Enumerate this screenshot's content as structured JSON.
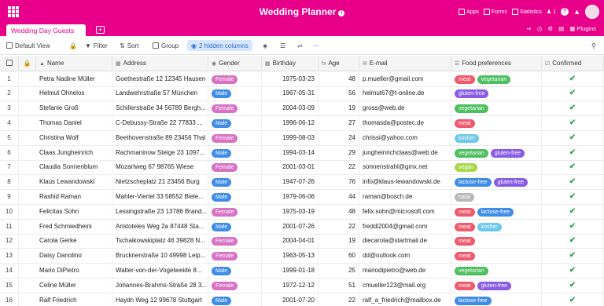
{
  "app": {
    "title": "Wedding Planner",
    "top_links": {
      "apps": "Apps",
      "forms": "Forms",
      "statistics": "Statistics",
      "users": "1"
    }
  },
  "tab": {
    "name": "Wedding Day Guests",
    "add": "+",
    "plugins": "Plugins"
  },
  "toolbar": {
    "view": "Default View",
    "filter": "Filter",
    "sort": "Sort",
    "group": "Group",
    "hidden": "2 hidden columns"
  },
  "columns": {
    "name": "Name",
    "address": "Address",
    "gender": "Gender",
    "birthday": "Birthday",
    "age": "Age",
    "email": "E-mail",
    "food": "Food preferences",
    "confirmed": "Confirmed"
  },
  "colors": {
    "brand": "#e8008a",
    "female": "#d772c4",
    "male": "#3f8de8",
    "meat": "#ef5a6f",
    "vegetarian": "#4cbf5e",
    "gluten-free": "#8a5ce6",
    "kosher": "#6fc8ea",
    "lactose-free": "#3f8de8",
    "vegan": "#a8d84a",
    "halal": "#b8b8b8"
  },
  "rows": [
    {
      "num": "1",
      "name": "Petra Nadine Müller",
      "address": "Goethestraße 12 12345 Hausen",
      "gender": "Female",
      "birthday": "1975-03-23",
      "age": "48",
      "email": "p.mueller@gmail.com",
      "food": [
        "meat",
        "vegetarian"
      ],
      "confirmed": true
    },
    {
      "num": "2",
      "name": "Helmut Ohnelos",
      "address": "Landwehrstraße 57 München",
      "gender": "Male",
      "birthday": "1967-05-31",
      "age": "56",
      "email": "helmut67@t-online.de",
      "food": [
        "gluten-free"
      ],
      "confirmed": true
    },
    {
      "num": "3",
      "name": "Stefanie Groß",
      "address": "Schillerstraße 34 56789 Bergh...",
      "gender": "Female",
      "birthday": "2004-03-09",
      "age": "19",
      "email": "gross@web.de",
      "food": [
        "vegetarian"
      ],
      "confirmed": true
    },
    {
      "num": "4",
      "name": "Thomas Daniel",
      "address": "C-Debussy-Straße 22 77833 ...",
      "gender": "Male",
      "birthday": "1996-06-12",
      "age": "27",
      "email": "thomasda@postec.de",
      "food": [
        "meat"
      ],
      "confirmed": true
    },
    {
      "num": "5",
      "name": "Christina Wolf",
      "address": "Beethovenstraße 89 23456 Thal",
      "gender": "Female",
      "birthday": "1999-08-03",
      "age": "24",
      "email": "chrissi@yahoo.com",
      "food": [
        "kosher"
      ],
      "confirmed": true
    },
    {
      "num": "6",
      "name": "Claas Jungheinrich",
      "address": "Rachmaninow Steige 23 1097...",
      "gender": "Male",
      "birthday": "1994-03-14",
      "age": "29",
      "email": "jungheinrichclaas@web.de",
      "food": [
        "vegetarian",
        "gluten-free"
      ],
      "confirmed": true
    },
    {
      "num": "7",
      "name": "Claudia Sonnenblum",
      "address": "Mozartweg 67 98765 Wiese",
      "gender": "Female",
      "birthday": "2001-03-01",
      "age": "22",
      "email": "sonnenstrahl@gmx.net",
      "food": [
        "vegan"
      ],
      "confirmed": true
    },
    {
      "num": "8",
      "name": "Klaus Lewandowski",
      "address": "Nietzscheplatz 21 23456 Burg",
      "gender": "Male",
      "birthday": "1947-07-26",
      "age": "76",
      "email": "info@klaus-lewandowski.de",
      "food": [
        "lactose-free",
        "gluten-free"
      ],
      "confirmed": true
    },
    {
      "num": "9",
      "name": "Rashid Raman",
      "address": "Mahler-Viertel 33 58552 Biele...",
      "gender": "Male",
      "birthday": "1979-06-06",
      "age": "44",
      "email": "raman@bosch.de",
      "food": [
        "halal"
      ],
      "confirmed": true
    },
    {
      "num": "10",
      "name": "Felicitas Sohn",
      "address": "Lessingstraße 23 13786 Brand...",
      "gender": "Female",
      "birthday": "1975-03-19",
      "age": "48",
      "email": "felix.sohn@microsoft.com",
      "food": [
        "meat",
        "lactose-free"
      ],
      "confirmed": true
    },
    {
      "num": "11",
      "name": "Fred Schmiedheini",
      "address": "Aristoteles Weg 2a 87448 Sta...",
      "gender": "Male",
      "birthday": "2001-07-26",
      "age": "22",
      "email": "freddi2004@gmail.com",
      "food": [
        "meat",
        "kosher"
      ],
      "confirmed": true
    },
    {
      "num": "12",
      "name": "Carola Gerke",
      "address": "Tschaikowskiplatz 46 39828 N...",
      "gender": "Female",
      "birthday": "2004-04-01",
      "age": "19",
      "email": "diecarola@startmail.de",
      "food": [
        "meat"
      ],
      "confirmed": true
    },
    {
      "num": "13",
      "name": "Daisy Danolino",
      "address": "Brucknerstraße 10 49998 Leip...",
      "gender": "Female",
      "birthday": "1963-05-13",
      "age": "60",
      "email": "dd@outlook.com",
      "food": [
        "meat"
      ],
      "confirmed": true
    },
    {
      "num": "14",
      "name": "Mario DiPietro",
      "address": "Walter-von-der-Vogelweide 8...",
      "gender": "Male",
      "birthday": "1999-01-18",
      "age": "25",
      "email": "mariodipietro@web.de",
      "food": [
        "vegetarian"
      ],
      "confirmed": true
    },
    {
      "num": "15",
      "name": "Celine Müller",
      "address": "Johannes-Brahms-Straße 28 3...",
      "gender": "Female",
      "birthday": "1972-12-12",
      "age": "51",
      "email": "cmueller123@mail.org",
      "food": [
        "meat",
        "gluten-free"
      ],
      "confirmed": true
    },
    {
      "num": "16",
      "name": "Ralf Friedrich",
      "address": "Haydn Weg 12 99678 Stuttgart",
      "gender": "Male",
      "birthday": "2001-07-20",
      "age": "22",
      "email": "ralf_a_friedrich@mailbox.de",
      "food": [
        "lactose-free"
      ],
      "confirmed": true
    }
  ]
}
